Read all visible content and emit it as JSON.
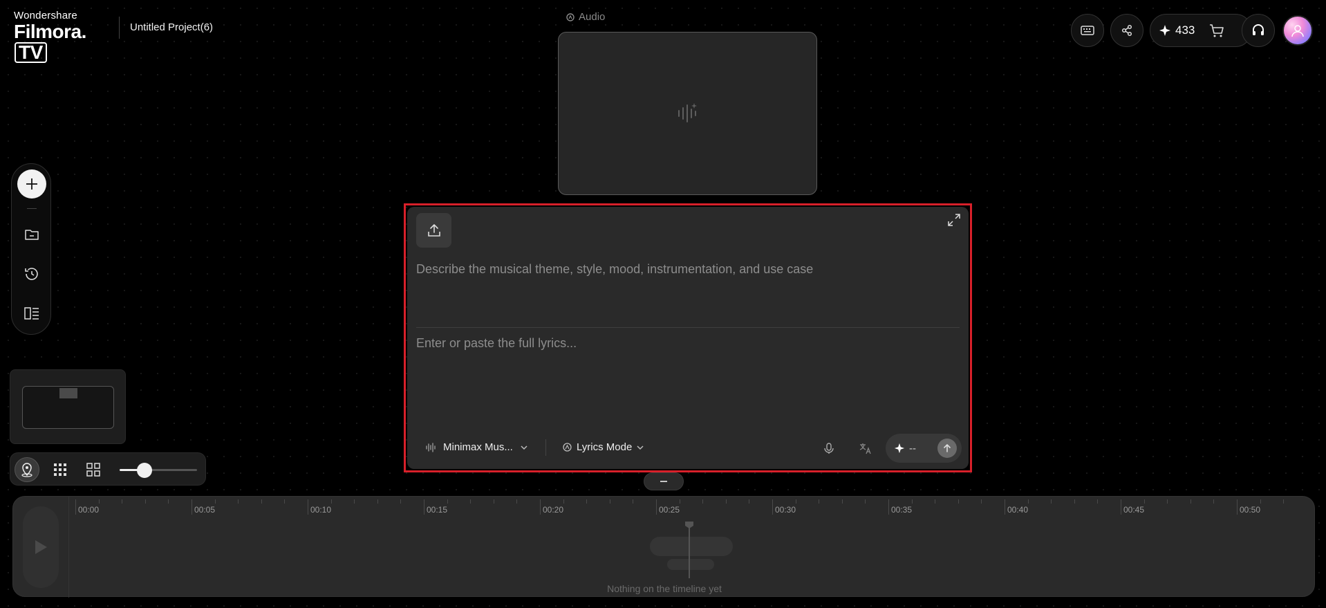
{
  "header": {
    "brand_top": "Wondershare",
    "brand_main": "Filmora.",
    "brand_tv": "TV",
    "project_name": "Untitled Project(6)",
    "section_label": "Audio",
    "credits": "433"
  },
  "composer": {
    "prompt_placeholder": "Describe the musical theme, style, mood, instrumentation, and use case",
    "lyrics_placeholder": "Enter or paste the full lyrics...",
    "model_label": "Minimax Mus...",
    "mode_label": "Lyrics Mode",
    "generate_cost": "--"
  },
  "timeline": {
    "ticks": [
      "00:00",
      "00:05",
      "00:10",
      "00:15",
      "00:20",
      "00:25",
      "00:30",
      "00:35",
      "00:40",
      "00:45",
      "00:50"
    ],
    "empty_message": "Nothing on the timeline yet"
  },
  "view": {
    "zoom_level": 0.25
  },
  "colors": {
    "highlight_border": "#d8202a",
    "panel_bg": "#2a2a2a",
    "page_bg": "#000000"
  }
}
